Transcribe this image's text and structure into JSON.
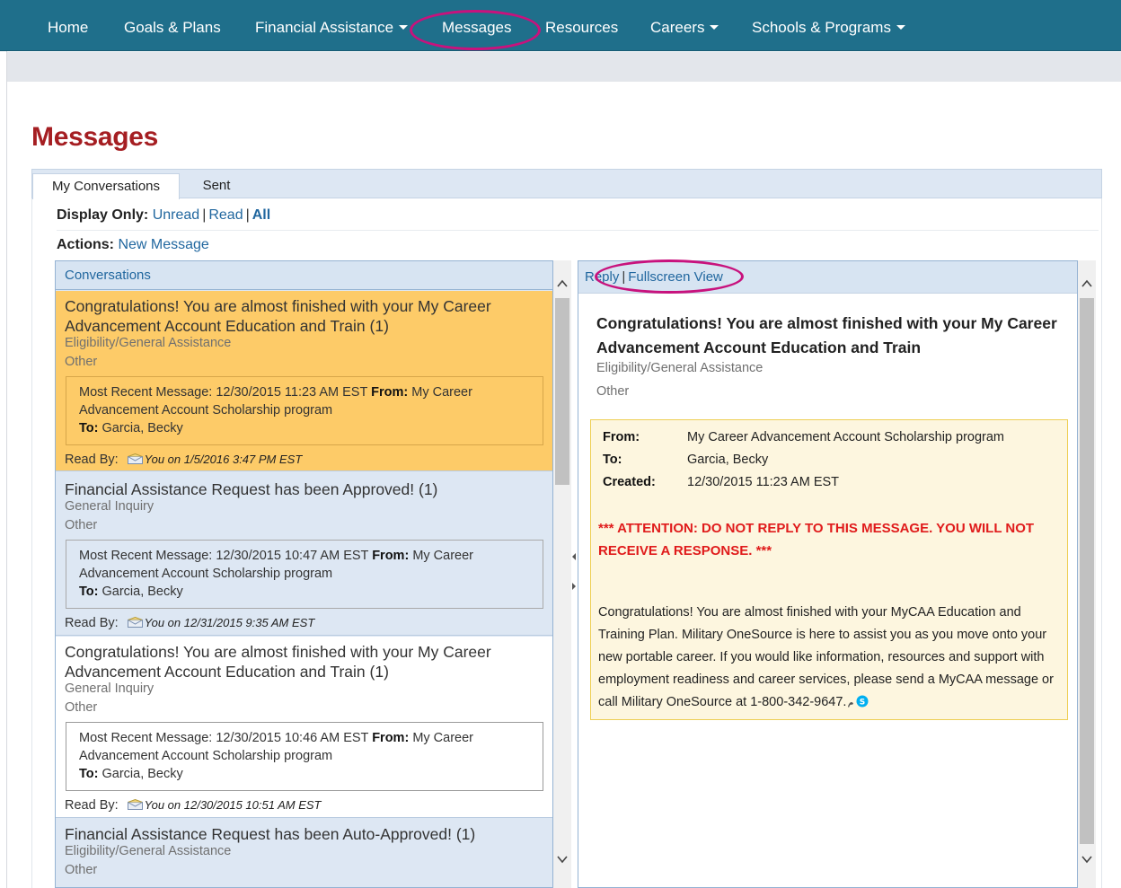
{
  "nav": {
    "items": [
      {
        "label": "Home"
      },
      {
        "label": "Goals & Plans"
      },
      {
        "label": "Financial Assistance",
        "has_dropdown": true
      },
      {
        "label": "Messages",
        "highlighted": true
      },
      {
        "label": "Resources"
      },
      {
        "label": "Careers",
        "has_dropdown": true
      },
      {
        "label": "Schools & Programs",
        "has_dropdown": true
      }
    ],
    "background": "#1f6f8b",
    "highlight_color": "#c8127d"
  },
  "page": {
    "title": "Messages",
    "title_color": "#a51e22"
  },
  "tabs": [
    {
      "label": "My Conversations",
      "active": true
    },
    {
      "label": "Sent",
      "active": false
    }
  ],
  "filters": {
    "display_label": "Display Only:",
    "options": [
      "Unread",
      "Read",
      "All"
    ],
    "selected": "All",
    "actions_label": "Actions:",
    "new_message": "New Message"
  },
  "conversations": {
    "header": "Conversations",
    "items": [
      {
        "title": "Congratulations! You are almost finished with your My Career Advancement Account Education and Train (1)",
        "category": "Eligibility/General Assistance",
        "type": "Other",
        "recent_prefix": "Most Recent Message: 12/30/2015 11:23 AM EST",
        "from_label": "From:",
        "from": "My Career Advancement Account Scholarship program",
        "to_label": "To:",
        "to": "Garcia, Becky",
        "read_by_label": "Read By:",
        "read_by": "You on 1/5/2016 3:47 PM EST",
        "selected": true
      },
      {
        "title": "Financial Assistance Request has been Approved! (1)",
        "category": "General Inquiry",
        "type": "Other",
        "recent_prefix": "Most Recent Message: 12/30/2015 10:47 AM EST",
        "from_label": "From:",
        "from": "My Career Advancement Account Scholarship program",
        "to_label": "To:",
        "to": "Garcia, Becky",
        "read_by_label": "Read By:",
        "read_by": "You on 12/31/2015 9:35 AM EST",
        "selected": false
      },
      {
        "title": "Congratulations! You are almost finished with your My Career Advancement Account Education and Train (1)",
        "category": "General Inquiry",
        "type": "Other",
        "recent_prefix": "Most Recent Message: 12/30/2015 10:46 AM EST",
        "from_label": "From:",
        "from": "My Career Advancement Account Scholarship program",
        "to_label": "To:",
        "to": "Garcia, Becky",
        "read_by_label": "Read By:",
        "read_by": "You on 12/30/2015 10:51 AM EST",
        "selected": false
      },
      {
        "title": "Financial Assistance Request has been Auto-Approved! (1)",
        "category": "Eligibility/General Assistance",
        "type": "Other",
        "selected": false
      }
    ]
  },
  "message": {
    "reply": "Reply",
    "fullscreen": "Fullscreen View",
    "title": "Congratulations! You are almost finished with your My Career Advancement Account Education and Train",
    "category": "Eligibility/General Assistance",
    "type": "Other",
    "from_label": "From:",
    "from": "My Career Advancement Account Scholarship program",
    "to_label": "To:",
    "to": "Garcia, Becky",
    "created_label": "Created:",
    "created": "12/30/2015 11:23 AM EST",
    "attention": "*** ATTENTION: DO NOT REPLY TO THIS MESSAGE. YOU WILL NOT RECEIVE A RESPONSE. ***",
    "body": "Congratulations! You are almost finished with your MyCAA Education and Training Plan. Military OneSource is here to assist you as you move onto your new portable career. If you would like information, resources and support with employment readiness and career services, please send a MyCAA message or call Military OneSource at 1-800-342-9647."
  }
}
